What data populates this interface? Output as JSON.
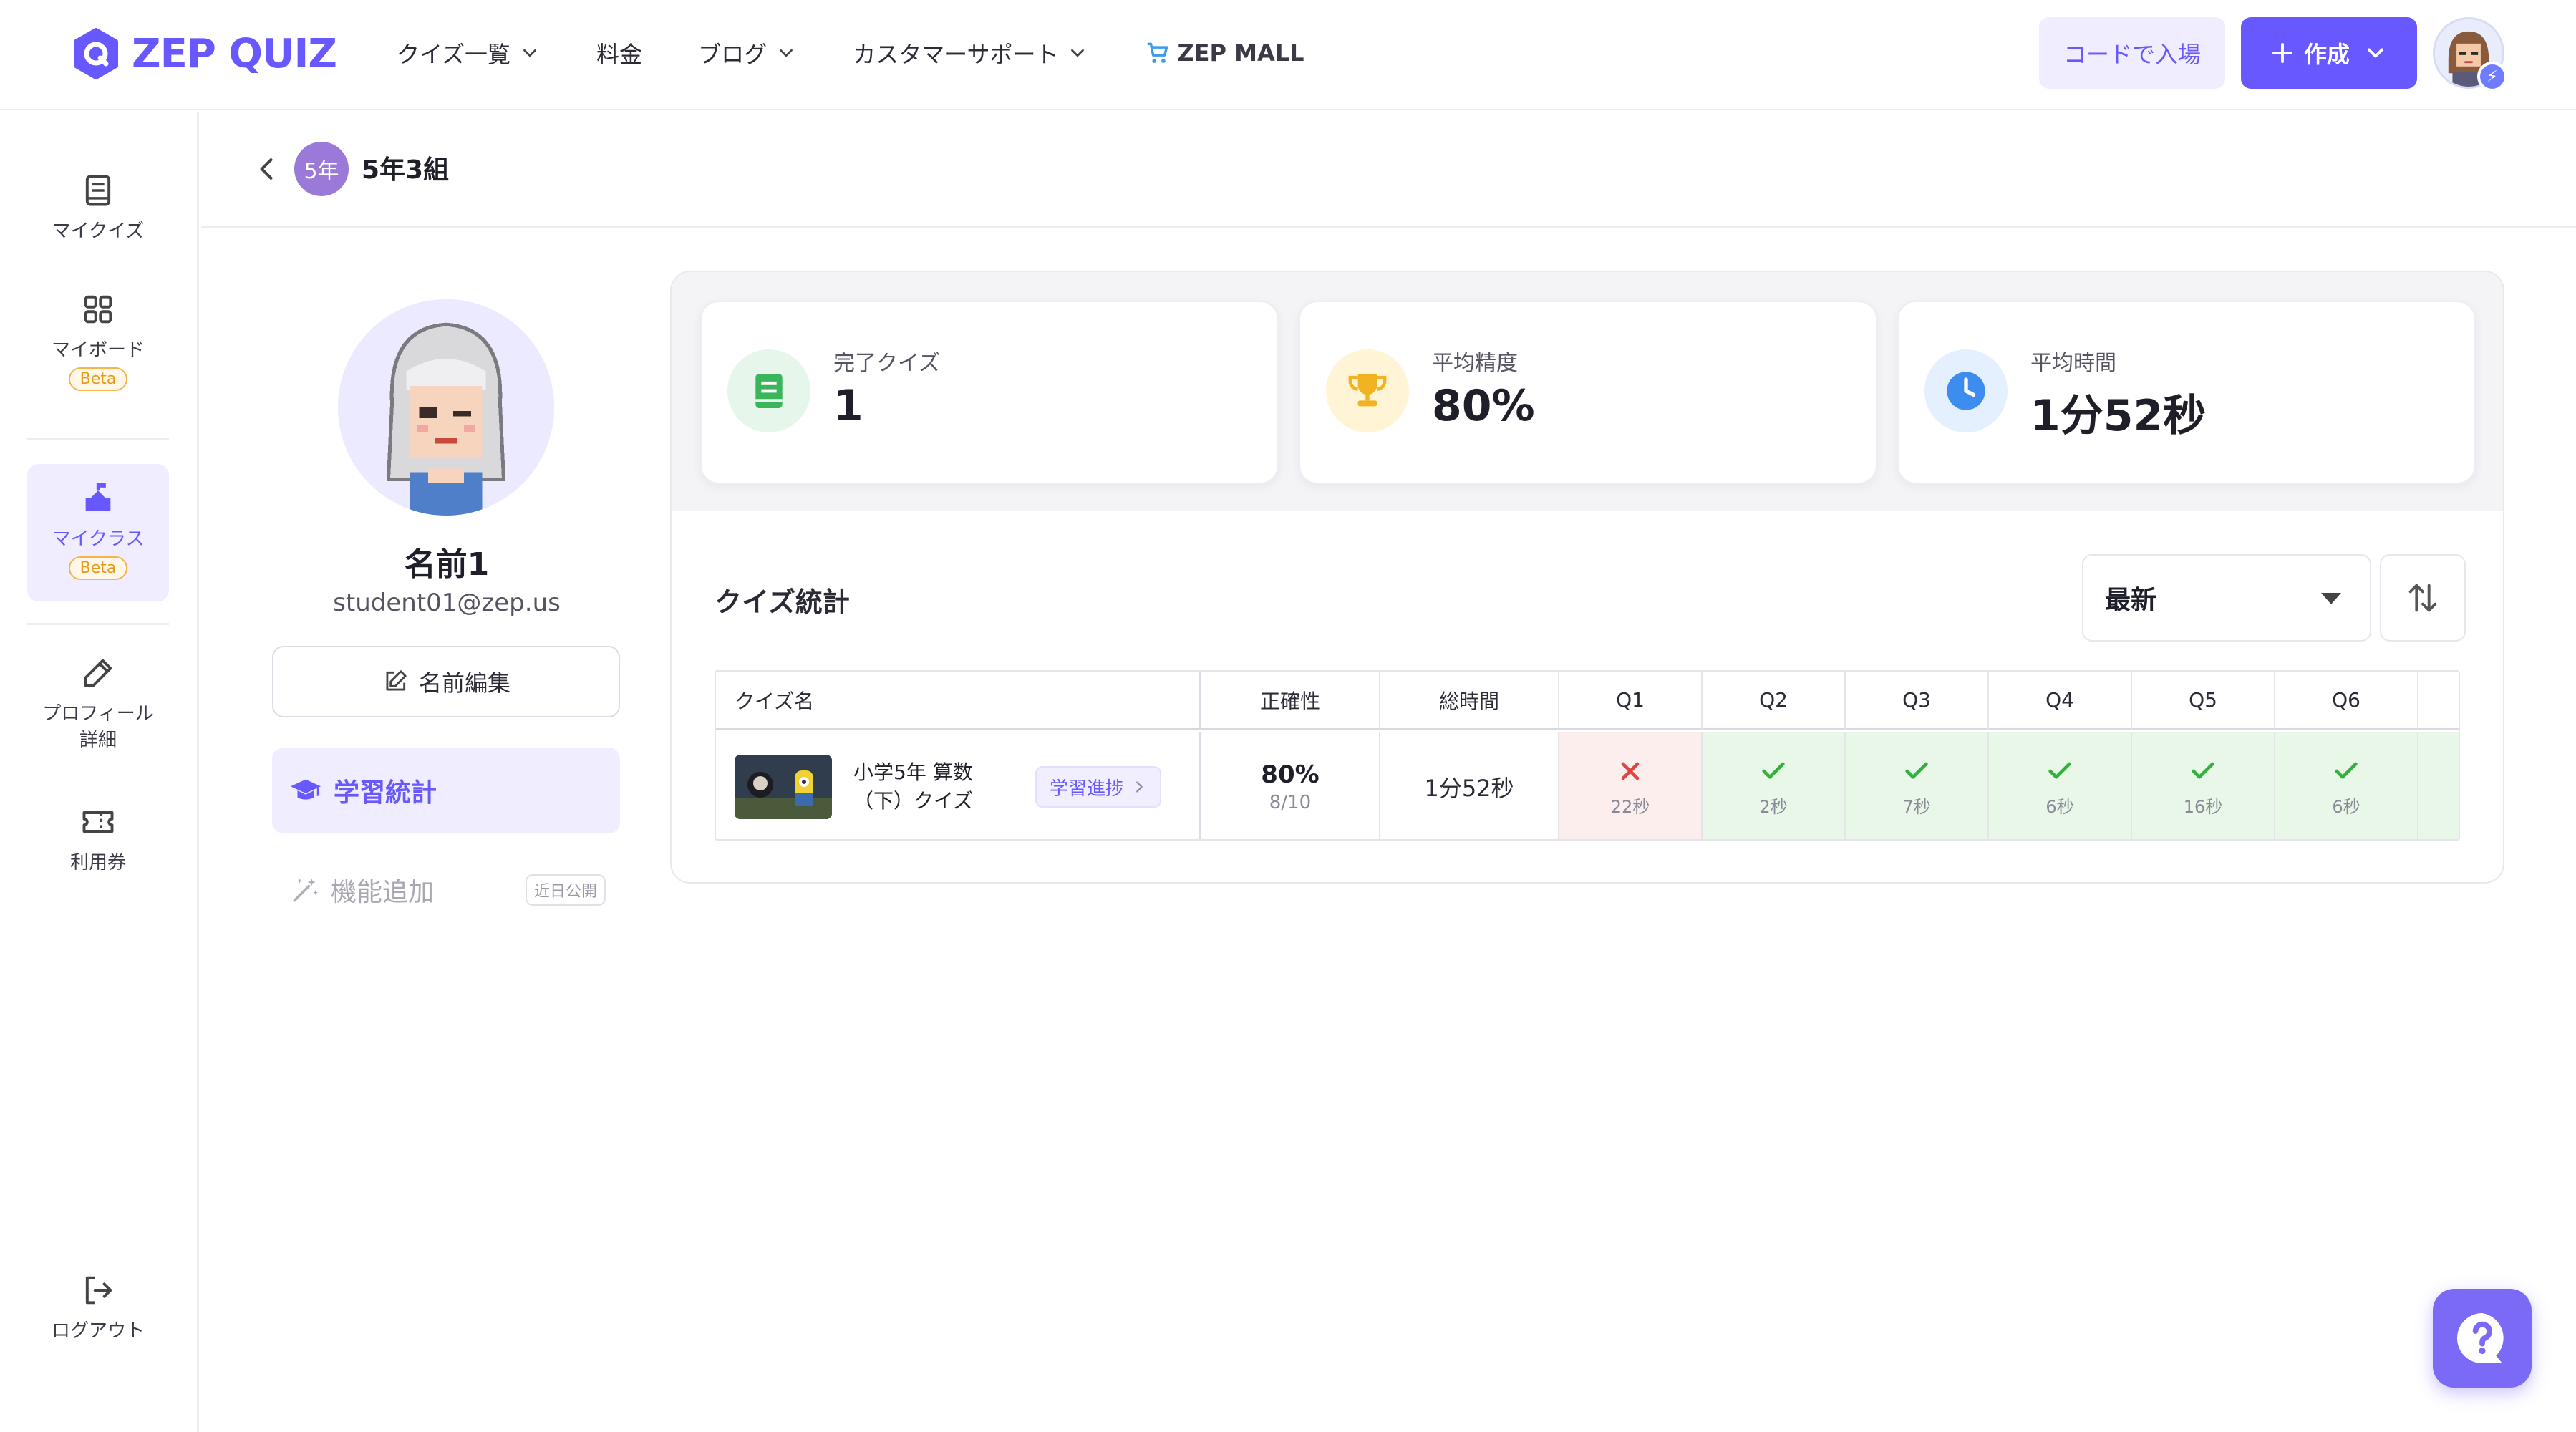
{
  "brand": {
    "name": "ZEP QUIZ",
    "accent": "#6758ff"
  },
  "nav": {
    "items": [
      {
        "label": "クイズ一覧",
        "has_dropdown": true
      },
      {
        "label": "料金",
        "has_dropdown": false
      },
      {
        "label": "ブログ",
        "has_dropdown": true
      },
      {
        "label": "カスタマーサポート",
        "has_dropdown": true
      }
    ],
    "mall_label": "ZEP MALL"
  },
  "header_actions": {
    "enter_code_label": "コードで入場",
    "create_label": "作成"
  },
  "sidebar": {
    "items": [
      {
        "label": "マイクイズ",
        "icon": "book-icon"
      },
      {
        "label": "マイボード",
        "icon": "grid-icon",
        "badge": "Beta"
      },
      {
        "label": "マイクラス",
        "icon": "class-icon",
        "badge": "Beta",
        "active": true
      },
      {
        "label": "プロフィール詳細",
        "line1": "プロフィール",
        "line2": "詳細",
        "icon": "pencil-icon"
      },
      {
        "label": "利用券",
        "icon": "ticket-icon"
      }
    ],
    "logout_label": "ログアウト"
  },
  "class": {
    "grade_badge": "5年",
    "name": "5年3組"
  },
  "student": {
    "name": "名前1",
    "email": "student01@zep.us",
    "edit_label": "名前編集",
    "menu": {
      "stats_label": "学習統計",
      "add_feature_label": "機能追加",
      "coming_soon": "近日公開"
    }
  },
  "stats": [
    {
      "label": "完了クイズ",
      "value": "1",
      "icon": "book-icon",
      "color": "#3bb55b"
    },
    {
      "label": "平均精度",
      "value": "80%",
      "icon": "trophy-icon",
      "color": "#f2b322"
    },
    {
      "label": "平均時間",
      "value": "1分52秒",
      "icon": "clock-icon",
      "color": "#3d8cf0"
    }
  ],
  "quiz_stats": {
    "title": "クイズ統計",
    "sort_value": "最新",
    "columns": {
      "quiz_name": "クイズ名",
      "accuracy": "正確性",
      "total_time": "総時間",
      "questions": [
        "Q1",
        "Q2",
        "Q3",
        "Q4",
        "Q5",
        "Q6"
      ]
    },
    "rows": [
      {
        "quiz_name_line1": "小学5年 算数",
        "quiz_name_line2": "（下）クイズ",
        "progress_label": "学習進捗",
        "accuracy": "80%",
        "score": "8/10",
        "total_time": "1分52秒",
        "answers": [
          {
            "correct": false,
            "time": "22秒"
          },
          {
            "correct": true,
            "time": "2秒"
          },
          {
            "correct": true,
            "time": "7秒"
          },
          {
            "correct": true,
            "time": "6秒"
          },
          {
            "correct": true,
            "time": "16秒"
          },
          {
            "correct": true,
            "time": "6秒"
          }
        ]
      }
    ]
  }
}
